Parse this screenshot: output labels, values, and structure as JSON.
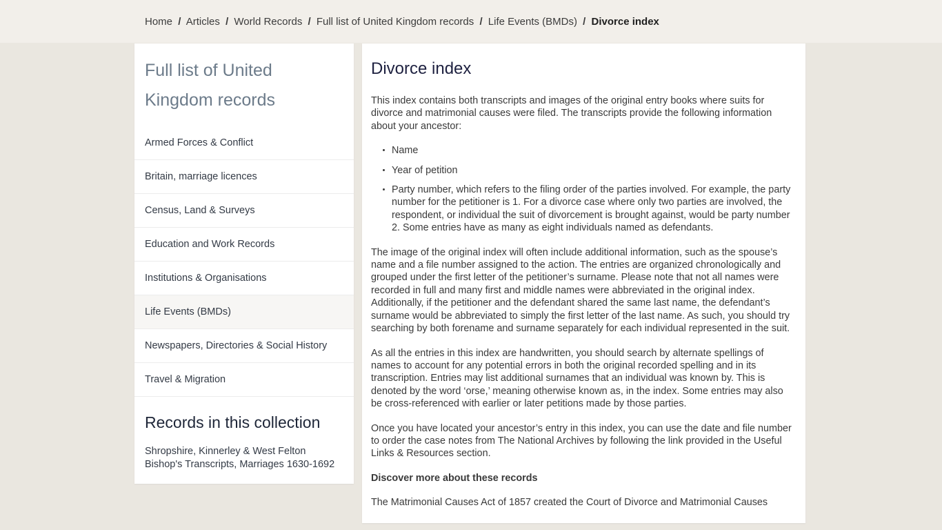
{
  "breadcrumb": {
    "separator": "/",
    "items": [
      {
        "label": "Home"
      },
      {
        "label": "Articles"
      },
      {
        "label": "World Records"
      },
      {
        "label": "Full list of United Kingdom records"
      },
      {
        "label": "Life Events (BMDs)"
      },
      {
        "label": "Divorce index"
      }
    ]
  },
  "sidebar": {
    "heading": "Full list of United Kingdom records",
    "items": [
      {
        "label": "Armed Forces & Conflict",
        "active": false
      },
      {
        "label": "Britain, marriage licences",
        "active": false
      },
      {
        "label": "Census, Land & Surveys",
        "active": false
      },
      {
        "label": "Education and Work Records",
        "active": false
      },
      {
        "label": "Institutions & Organisations",
        "active": false
      },
      {
        "label": "Life Events (BMDs)",
        "active": true
      },
      {
        "label": "Newspapers, Directories & Social History",
        "active": false
      },
      {
        "label": "Travel & Migration",
        "active": false
      }
    ],
    "collection_heading": "Records in this collection",
    "collection_items": [
      {
        "label": "Shropshire, Kinnerley & West Felton Bishop's Transcripts, Marriages 1630-1692"
      }
    ]
  },
  "main": {
    "title": "Divorce index",
    "intro": "This index contains both transcripts and images of the original entry books where suits for divorce and matrimonial causes were filed. The transcripts provide the following information about your ancestor:",
    "bullets": [
      "Name",
      "Year of petition",
      "Party number, which refers to the filing order of the parties involved. For example, the party number for the petitioner is 1. For a divorce case where only two parties are involved, the respondent, or individual the suit of divorcement is brought against, would be party number 2. Some entries have as many as eight individuals named as defendants."
    ],
    "paragraph_2": "The image of the original index will often include additional information, such as the spouse’s name and a file number assigned to the action. The entries are organized chronologically and grouped under the first letter of the petitioner’s surname. Please note that not all names were recorded in full and many first and middle names were abbreviated in the original index. Additionally, if the petitioner and the defendant shared the same last name, the defendant’s surname would be abbreviated to simply the first letter of the last name. As such, you should try searching by both forename and surname separately for each individual represented in the suit.",
    "paragraph_3": "As all the entries in this index are handwritten, you should search by alternate spellings of names to account for any potential errors in both the original recorded spelling and in its transcription. Entries may list additional surnames that an individual was known by. This is denoted by the word ‘orse,’ meaning otherwise known as, in the index. Some entries may also be cross-referenced with earlier or later petitions made by those parties.",
    "paragraph_4": "Once you have located your ancestor’s entry in this index, you can use the date and file number to order the case notes from The National Archives by following the link provided in the Useful Links & Resources section.",
    "discover_heading": "Discover more about these records",
    "paragraph_5": "The Matrimonial Causes Act of 1857 created the Court of Divorce and Matrimonial Causes"
  },
  "colors": {
    "page_background": "#eae7e0",
    "top_strip": "#f2efea",
    "panel": "#ffffff",
    "sidebar_heading": "#6c7b8a",
    "title": "#1e2140",
    "body_text": "#3a3a3a",
    "active_item": "#f7f6f4"
  }
}
